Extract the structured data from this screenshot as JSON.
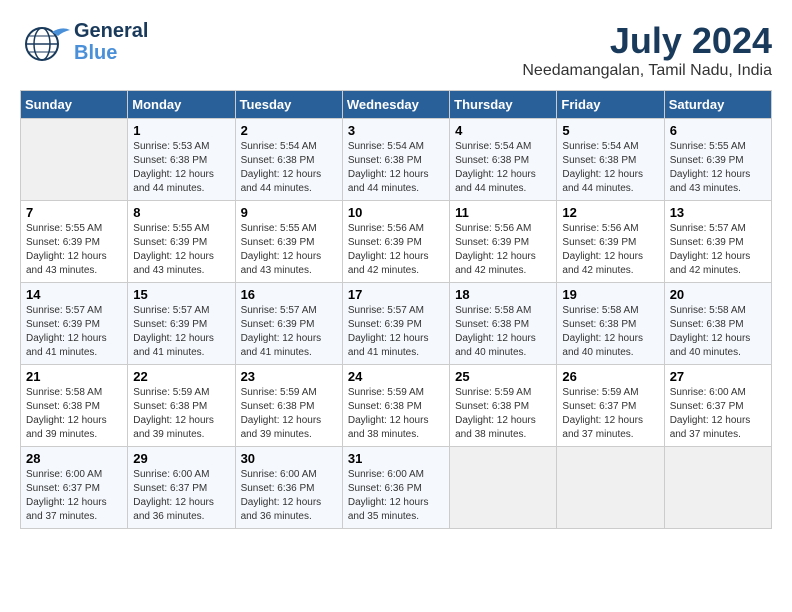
{
  "header": {
    "logo_line1": "General",
    "logo_line2": "Blue",
    "month_year": "July 2024",
    "location": "Needamangalan, Tamil Nadu, India"
  },
  "days_of_week": [
    "Sunday",
    "Monday",
    "Tuesday",
    "Wednesday",
    "Thursday",
    "Friday",
    "Saturday"
  ],
  "weeks": [
    [
      {
        "day": "",
        "info": ""
      },
      {
        "day": "1",
        "info": "Sunrise: 5:53 AM\nSunset: 6:38 PM\nDaylight: 12 hours\nand 44 minutes."
      },
      {
        "day": "2",
        "info": "Sunrise: 5:54 AM\nSunset: 6:38 PM\nDaylight: 12 hours\nand 44 minutes."
      },
      {
        "day": "3",
        "info": "Sunrise: 5:54 AM\nSunset: 6:38 PM\nDaylight: 12 hours\nand 44 minutes."
      },
      {
        "day": "4",
        "info": "Sunrise: 5:54 AM\nSunset: 6:38 PM\nDaylight: 12 hours\nand 44 minutes."
      },
      {
        "day": "5",
        "info": "Sunrise: 5:54 AM\nSunset: 6:38 PM\nDaylight: 12 hours\nand 44 minutes."
      },
      {
        "day": "6",
        "info": "Sunrise: 5:55 AM\nSunset: 6:39 PM\nDaylight: 12 hours\nand 43 minutes."
      }
    ],
    [
      {
        "day": "7",
        "info": "Sunrise: 5:55 AM\nSunset: 6:39 PM\nDaylight: 12 hours\nand 43 minutes."
      },
      {
        "day": "8",
        "info": "Sunrise: 5:55 AM\nSunset: 6:39 PM\nDaylight: 12 hours\nand 43 minutes."
      },
      {
        "day": "9",
        "info": "Sunrise: 5:55 AM\nSunset: 6:39 PM\nDaylight: 12 hours\nand 43 minutes."
      },
      {
        "day": "10",
        "info": "Sunrise: 5:56 AM\nSunset: 6:39 PM\nDaylight: 12 hours\nand 42 minutes."
      },
      {
        "day": "11",
        "info": "Sunrise: 5:56 AM\nSunset: 6:39 PM\nDaylight: 12 hours\nand 42 minutes."
      },
      {
        "day": "12",
        "info": "Sunrise: 5:56 AM\nSunset: 6:39 PM\nDaylight: 12 hours\nand 42 minutes."
      },
      {
        "day": "13",
        "info": "Sunrise: 5:57 AM\nSunset: 6:39 PM\nDaylight: 12 hours\nand 42 minutes."
      }
    ],
    [
      {
        "day": "14",
        "info": "Sunrise: 5:57 AM\nSunset: 6:39 PM\nDaylight: 12 hours\nand 41 minutes."
      },
      {
        "day": "15",
        "info": "Sunrise: 5:57 AM\nSunset: 6:39 PM\nDaylight: 12 hours\nand 41 minutes."
      },
      {
        "day": "16",
        "info": "Sunrise: 5:57 AM\nSunset: 6:39 PM\nDaylight: 12 hours\nand 41 minutes."
      },
      {
        "day": "17",
        "info": "Sunrise: 5:57 AM\nSunset: 6:39 PM\nDaylight: 12 hours\nand 41 minutes."
      },
      {
        "day": "18",
        "info": "Sunrise: 5:58 AM\nSunset: 6:38 PM\nDaylight: 12 hours\nand 40 minutes."
      },
      {
        "day": "19",
        "info": "Sunrise: 5:58 AM\nSunset: 6:38 PM\nDaylight: 12 hours\nand 40 minutes."
      },
      {
        "day": "20",
        "info": "Sunrise: 5:58 AM\nSunset: 6:38 PM\nDaylight: 12 hours\nand 40 minutes."
      }
    ],
    [
      {
        "day": "21",
        "info": "Sunrise: 5:58 AM\nSunset: 6:38 PM\nDaylight: 12 hours\nand 39 minutes."
      },
      {
        "day": "22",
        "info": "Sunrise: 5:59 AM\nSunset: 6:38 PM\nDaylight: 12 hours\nand 39 minutes."
      },
      {
        "day": "23",
        "info": "Sunrise: 5:59 AM\nSunset: 6:38 PM\nDaylight: 12 hours\nand 39 minutes."
      },
      {
        "day": "24",
        "info": "Sunrise: 5:59 AM\nSunset: 6:38 PM\nDaylight: 12 hours\nand 38 minutes."
      },
      {
        "day": "25",
        "info": "Sunrise: 5:59 AM\nSunset: 6:38 PM\nDaylight: 12 hours\nand 38 minutes."
      },
      {
        "day": "26",
        "info": "Sunrise: 5:59 AM\nSunset: 6:37 PM\nDaylight: 12 hours\nand 37 minutes."
      },
      {
        "day": "27",
        "info": "Sunrise: 6:00 AM\nSunset: 6:37 PM\nDaylight: 12 hours\nand 37 minutes."
      }
    ],
    [
      {
        "day": "28",
        "info": "Sunrise: 6:00 AM\nSunset: 6:37 PM\nDaylight: 12 hours\nand 37 minutes."
      },
      {
        "day": "29",
        "info": "Sunrise: 6:00 AM\nSunset: 6:37 PM\nDaylight: 12 hours\nand 36 minutes."
      },
      {
        "day": "30",
        "info": "Sunrise: 6:00 AM\nSunset: 6:36 PM\nDaylight: 12 hours\nand 36 minutes."
      },
      {
        "day": "31",
        "info": "Sunrise: 6:00 AM\nSunset: 6:36 PM\nDaylight: 12 hours\nand 35 minutes."
      },
      {
        "day": "",
        "info": ""
      },
      {
        "day": "",
        "info": ""
      },
      {
        "day": "",
        "info": ""
      }
    ]
  ]
}
